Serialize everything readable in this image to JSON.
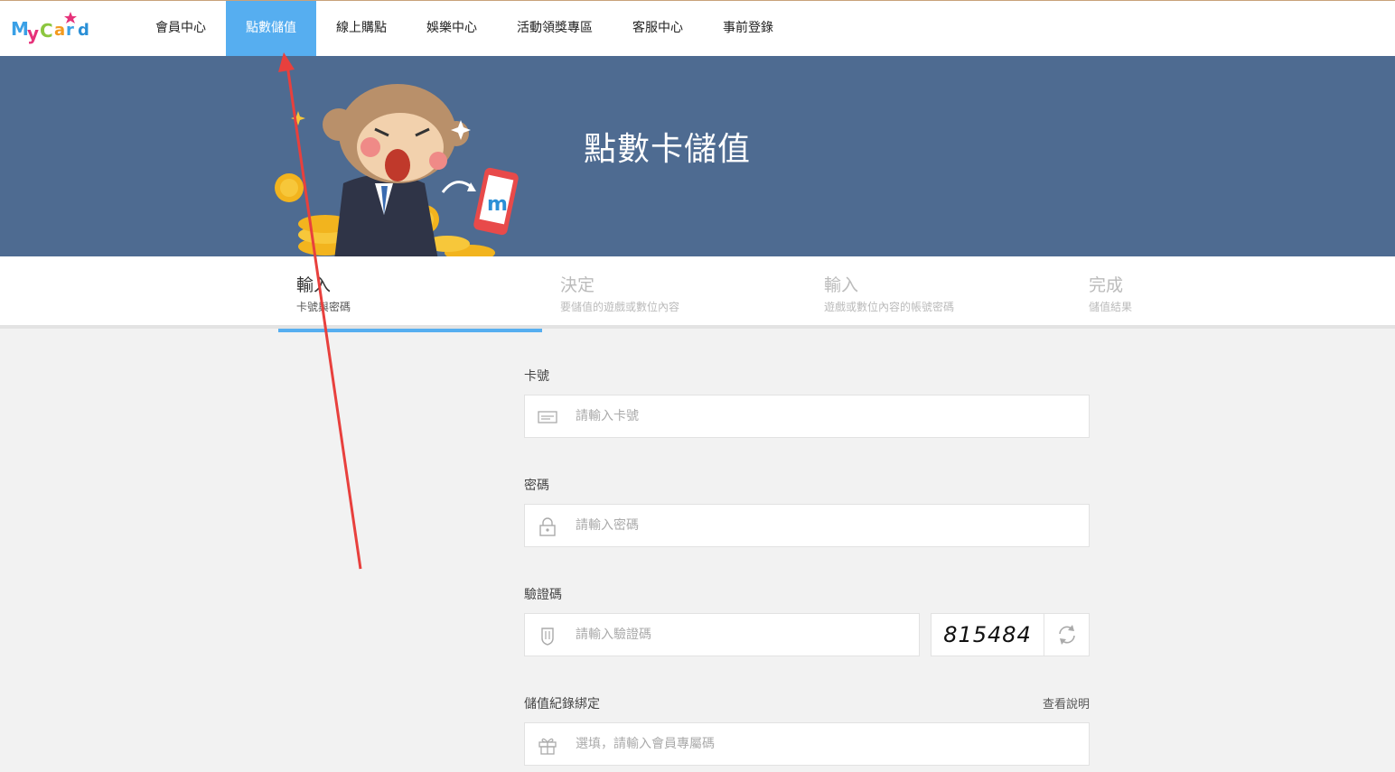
{
  "logo_text": "MyCard",
  "nav": [
    "會員中心",
    "點數儲值",
    "線上購點",
    "娛樂中心",
    "活動領獎專區",
    "客服中心",
    "事前登錄"
  ],
  "nav_active_index": 1,
  "banner": {
    "title": "點數卡儲值",
    "phone_logo": "m"
  },
  "steps": [
    {
      "title": "輸入",
      "sub": "卡號與密碼"
    },
    {
      "title": "決定",
      "sub": "要儲值的遊戲或數位內容"
    },
    {
      "title": "輸入",
      "sub": "遊戲或數位內容的帳號密碼"
    },
    {
      "title": "完成",
      "sub": "儲值結果"
    }
  ],
  "form": {
    "card_label": "卡號",
    "card_placeholder": "請輸入卡號",
    "card_icon": "card-icon",
    "password_label": "密碼",
    "password_placeholder": "請輸入密碼",
    "password_icon": "lock-icon",
    "captcha_label": "驗證碼",
    "captcha_placeholder": "請輸入驗證碼",
    "captcha_icon": "shield-icon",
    "captcha_code": "815484",
    "refresh_icon": "refresh-icon",
    "bind_label": "儲值紀錄綁定",
    "bind_help": "查看說明",
    "bind_placeholder": "選填，請輸入會員專屬碼",
    "bind_icon": "gift-icon"
  },
  "colors": {
    "accent": "#56aef0",
    "banner": "#4e6b91",
    "annotation_arrow": "#e8403d"
  }
}
